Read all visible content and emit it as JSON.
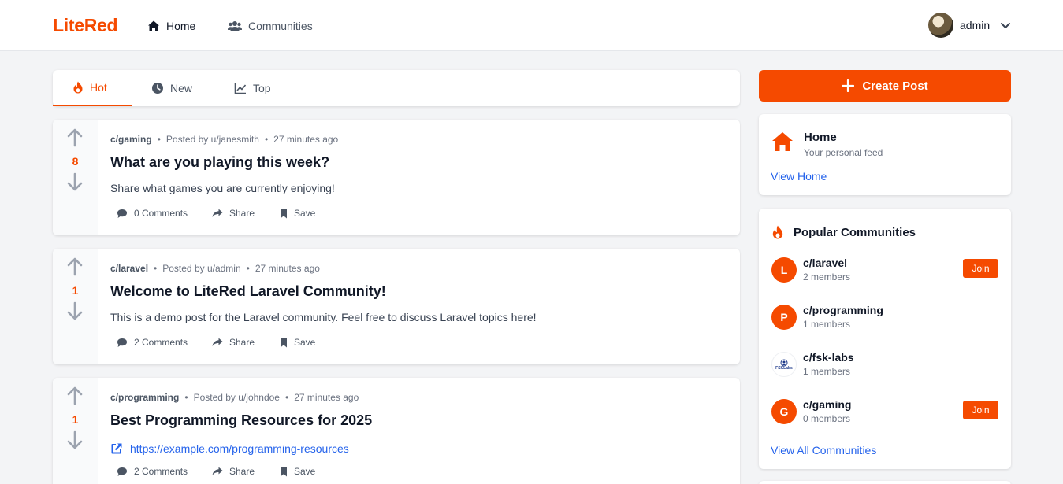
{
  "header": {
    "logo": "LiteRed",
    "nav": {
      "home": "Home",
      "communities": "Communities"
    },
    "user": {
      "name": "admin"
    }
  },
  "tabs": {
    "hot": "Hot",
    "new": "New",
    "top": "Top",
    "active": "hot"
  },
  "posts": [
    {
      "community": "c/gaming",
      "posted_by": "Posted by u/janesmith",
      "time": "27 minutes ago",
      "score": "8",
      "title": "What are you playing this week?",
      "body": "Share what games you are currently enjoying!",
      "comments": "0 Comments",
      "share": "Share",
      "save": "Save"
    },
    {
      "community": "c/laravel",
      "posted_by": "Posted by u/admin",
      "time": "27 minutes ago",
      "score": "1",
      "title": "Welcome to LiteRed Laravel Community!",
      "body": "This is a demo post for the Laravel community. Feel free to discuss Laravel topics here!",
      "comments": "2 Comments",
      "share": "Share",
      "save": "Save"
    },
    {
      "community": "c/programming",
      "posted_by": "Posted by u/johndoe",
      "time": "27 minutes ago",
      "score": "1",
      "title": "Best Programming Resources for 2025",
      "link": "https://example.com/programming-resources",
      "comments": "2 Comments",
      "share": "Share",
      "save": "Save"
    }
  ],
  "sidebar": {
    "create_post": "Create Post",
    "home_card": {
      "title": "Home",
      "subtitle": "Your personal feed",
      "link": "View Home"
    },
    "popular": {
      "title": "Popular Communities",
      "communities": [
        {
          "initial": "L",
          "name": "c/laravel",
          "members": "2 members",
          "join": "Join"
        },
        {
          "initial": "P",
          "name": "c/programming",
          "members": "1 members"
        },
        {
          "logo_text": "FSKLabs",
          "name": "c/fsk-labs",
          "members": "1 members"
        },
        {
          "initial": "G",
          "name": "c/gaming",
          "members": "0 members",
          "join": "Join"
        }
      ],
      "view_all": "View All Communities"
    }
  },
  "colors": {
    "accent": "#f54a00",
    "link": "#2563eb",
    "background": "#f3f4f6"
  }
}
